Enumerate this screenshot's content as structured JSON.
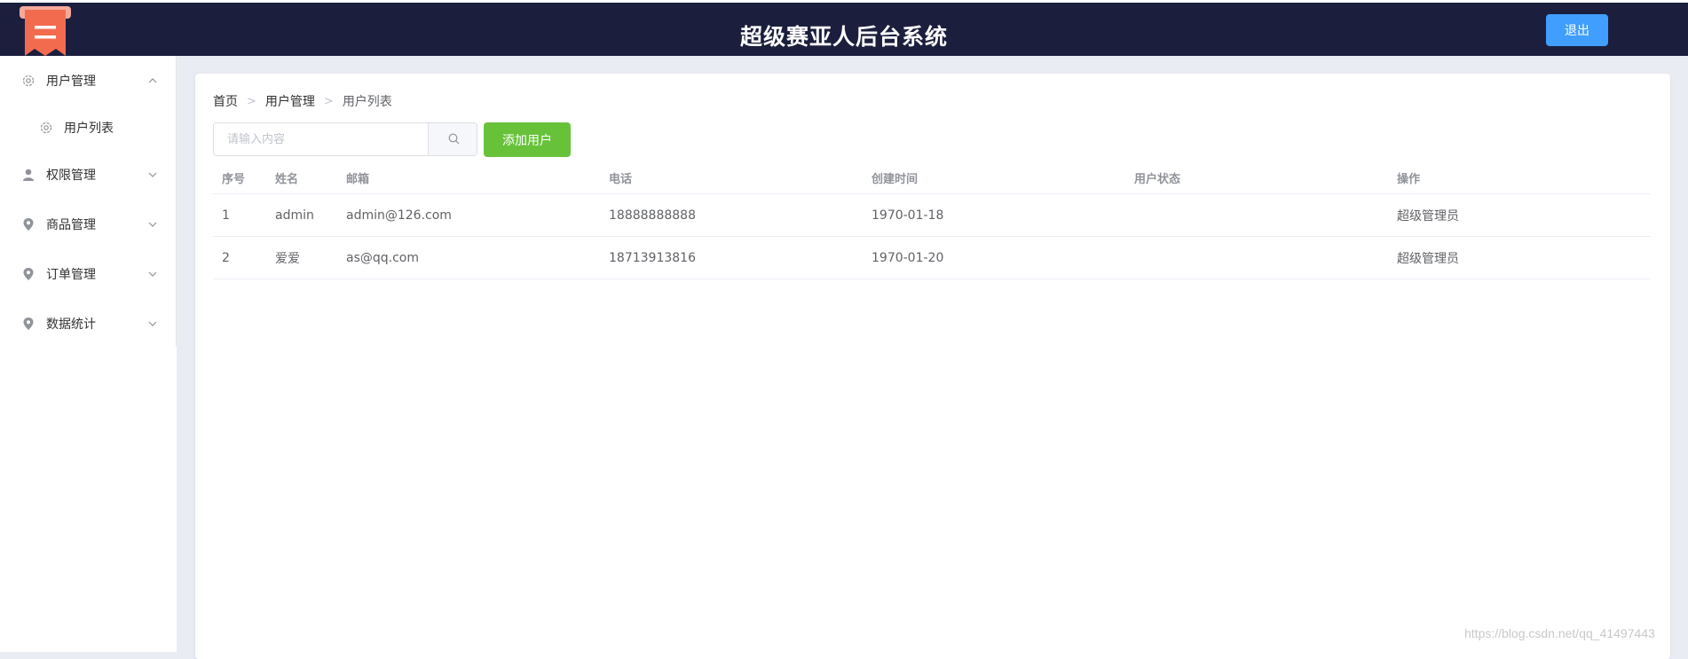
{
  "header": {
    "title": "超级赛亚人后台系统",
    "logout_label": "退出",
    "brand_color": "#1b1f3d",
    "logo_color": "#f26b4f"
  },
  "sidebar": {
    "menus": [
      {
        "label": "用户管理",
        "icon": "gear-icon",
        "expanded": true,
        "children": [
          {
            "label": "用户列表",
            "icon": "gear-icon"
          }
        ]
      },
      {
        "label": "权限管理",
        "icon": "user-icon",
        "expanded": false
      },
      {
        "label": "商品管理",
        "icon": "location-icon",
        "expanded": false
      },
      {
        "label": "订单管理",
        "icon": "location-icon",
        "expanded": false
      },
      {
        "label": "数据统计",
        "icon": "location-icon",
        "expanded": false
      }
    ]
  },
  "breadcrumb": [
    "首页",
    "用户管理",
    "用户列表"
  ],
  "search": {
    "placeholder": "请输入内容",
    "value": ""
  },
  "add_button_label": "添加用户",
  "table": {
    "headers": [
      "序号",
      "姓名",
      "邮箱",
      "电话",
      "创建时间",
      "用户状态",
      "操作"
    ],
    "rows": [
      [
        "1",
        "admin",
        "admin@126.com",
        "18888888888",
        "1970-01-18",
        "",
        "超级管理员"
      ],
      [
        "2",
        "爱爱",
        "as@qq.com",
        "18713913816",
        "1970-01-20",
        "",
        "超级管理员"
      ]
    ]
  },
  "watermark": "https://blog.csdn.net/qq_41497443",
  "colors": {
    "primary": "#409eff",
    "success": "#67c23a"
  }
}
